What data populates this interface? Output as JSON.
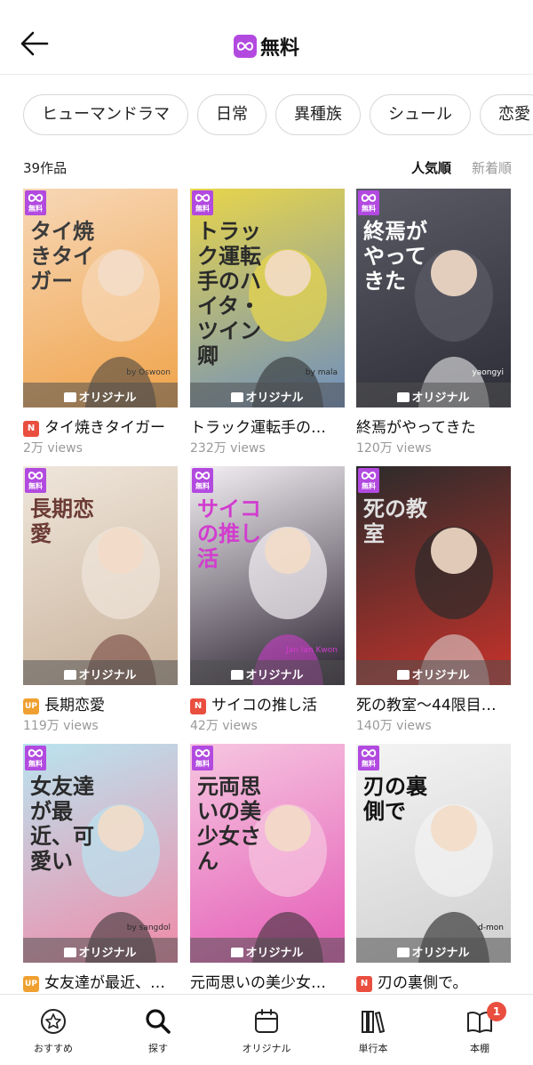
{
  "header": {
    "title": "無料",
    "back_icon": "arrow-left-icon"
  },
  "genres": [
    "ヒューマンドラマ",
    "日常",
    "異種族",
    "シュール",
    "恋愛"
  ],
  "list": {
    "count": "39作品",
    "sort_popular": "人気順",
    "sort_new": "新着順"
  },
  "badge": {
    "free_label": "無料",
    "original_label": "オリジナル"
  },
  "works": [
    {
      "title": "タイ焼きタイガー",
      "views": "2万 views",
      "tag": "N",
      "art_text": "タイ焼きタイガー",
      "credit": "by Oswoon"
    },
    {
      "title": "トラック運転手の…",
      "views": "232万 views",
      "tag": "",
      "art_text": "トラック運転手のハイタ・ツイン卿",
      "credit": "by mala"
    },
    {
      "title": "終焉がやってきた",
      "views": "120万 views",
      "tag": "",
      "art_text": "終焉がやってきた",
      "credit": "yaongyi"
    },
    {
      "title": "長期恋愛",
      "views": "119万 views",
      "tag": "UP",
      "art_text": "長期恋愛",
      "credit": ""
    },
    {
      "title": "サイコの推し活",
      "views": "42万 views",
      "tag": "N",
      "art_text": "サイコの推し活",
      "credit": "Jan Ian Kwon"
    },
    {
      "title": "死の教室～44限目…",
      "views": "140万 views",
      "tag": "",
      "art_text": "死の教室",
      "credit": ""
    },
    {
      "title": "女友達が最近、…",
      "views": "",
      "tag": "UP",
      "art_text": "女友達が最近、可愛い",
      "credit": "by sangdol"
    },
    {
      "title": "元両思いの美少女…",
      "views": "",
      "tag": "",
      "art_text": "元両思いの美少女さん",
      "credit": ""
    },
    {
      "title": "刃の裏側で。",
      "views": "",
      "tag": "N",
      "art_text": "刃の裏側で",
      "credit": "d-mon"
    }
  ],
  "nav": [
    {
      "label": "おすすめ",
      "icon": "star-badge-icon"
    },
    {
      "label": "探す",
      "icon": "search-icon"
    },
    {
      "label": "オリジナル",
      "icon": "calendar-icon"
    },
    {
      "label": "単行本",
      "icon": "books-icon"
    },
    {
      "label": "本棚",
      "icon": "book-open-icon",
      "badge": "1"
    }
  ],
  "colors": {
    "free_purple": "#b24ae0",
    "new_red": "#e94e3f",
    "up_orange": "#f0a030"
  }
}
